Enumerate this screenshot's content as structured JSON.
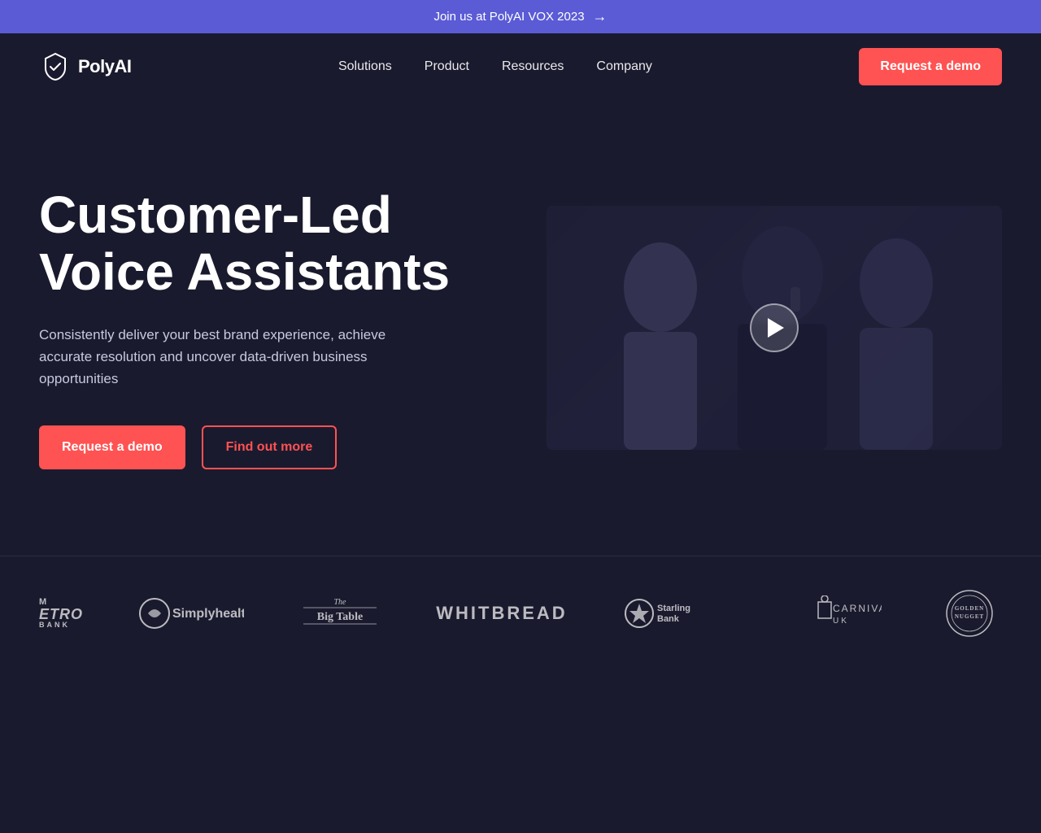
{
  "banner": {
    "text": "Join us at PolyAI VOX 2023",
    "arrow": "→"
  },
  "nav": {
    "logo_text": "PolyAI",
    "links": [
      {
        "label": "Solutions",
        "id": "solutions"
      },
      {
        "label": "Product",
        "id": "product"
      },
      {
        "label": "Resources",
        "id": "resources"
      },
      {
        "label": "Company",
        "id": "company"
      }
    ],
    "cta_label": "Request a demo"
  },
  "hero": {
    "title_line1": "Customer-Led",
    "title_line2": "Voice Assistants",
    "subtitle": "Consistently deliver your best brand experience, achieve accurate resolution and uncover data-driven business opportunities",
    "btn_primary": "Request a demo",
    "btn_outline": "Find out more"
  },
  "logos": [
    {
      "id": "metro-bank",
      "text": "METRO BANK",
      "style": "metro"
    },
    {
      "id": "simplyhealth",
      "text": "Simplyhealth",
      "style": "circle"
    },
    {
      "id": "big-table",
      "text": "The Big Table",
      "style": "script"
    },
    {
      "id": "whitbread",
      "text": "WHITBREAD",
      "style": "bold"
    },
    {
      "id": "starling-bank",
      "text": "Starling Bank",
      "style": "circle"
    },
    {
      "id": "carnival-uk",
      "text": "CARNIVAL UK",
      "style": "thin"
    },
    {
      "id": "golden-nugget",
      "text": "GOLDEN NUGGET",
      "style": "ornate"
    }
  ],
  "colors": {
    "banner_bg": "#5b5bd6",
    "body_bg": "#1a1a2e",
    "accent": "#ff5252",
    "nav_bg": "#1a1a2e",
    "text_primary": "#ffffff",
    "text_secondary": "#c8c8e0"
  }
}
